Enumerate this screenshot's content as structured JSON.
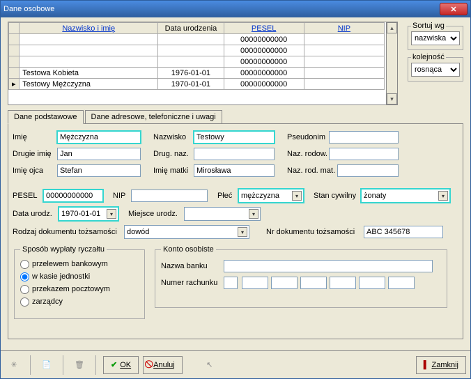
{
  "title": "Dane osobowe",
  "grid": {
    "headers": {
      "name": "Nazwisko i imię",
      "dob": "Data urodzenia",
      "pesel": "PESEL",
      "nip": "NIP"
    },
    "rows": [
      {
        "name": "",
        "dob": "",
        "pesel": "00000000000",
        "nip": ""
      },
      {
        "name": "",
        "dob": "",
        "pesel": "00000000000",
        "nip": ""
      },
      {
        "name": "",
        "dob": "",
        "pesel": "00000000000",
        "nip": ""
      },
      {
        "name": "Testowa Kobieta",
        "dob": "1976-01-01",
        "pesel": "00000000000",
        "nip": ""
      },
      {
        "name": "Testowy Mężczyzna",
        "dob": "1970-01-01",
        "pesel": "00000000000",
        "nip": "",
        "current": true
      }
    ]
  },
  "sort": {
    "legend1": "Sortuj wg",
    "value1": "nazwiska",
    "legend2": "kolejność",
    "value2": "rosnąca"
  },
  "tabs": {
    "t1": "Dane podstawowe",
    "t2": "Dane adresowe, telefoniczne i uwagi"
  },
  "labels": {
    "imie": "Imię",
    "nazwisko": "Nazwisko",
    "pseudonim": "Pseudonim",
    "drugieimie": "Drugie imię",
    "drugnaz": "Drug. naz.",
    "nazrodow": "Naz. rodow.",
    "imieojca": "Imię ojca",
    "imiematki": "Imię matki",
    "nazrodmat": "Naz. rod. mat.",
    "pesel": "PESEL",
    "nip": "NIP",
    "plec": "Płeć",
    "stan": "Stan cywilny",
    "dataurodz": "Data urodz.",
    "miejsceurodz": "Miejsce urodz.",
    "rodzdok": "Rodzaj dokumentu tożsamości",
    "nrdok": "Nr dokumentu tożsamości",
    "sposob": "Sposób wypłaty ryczałtu",
    "konto": "Konto osobiste",
    "nazwabanku": "Nazwa banku",
    "numerrach": "Numer rachunku",
    "r1": "przelewem bankowym",
    "r2": "w kasie jednostki",
    "r3": "przekazem pocztowym",
    "r4": "zarządcy"
  },
  "values": {
    "imie": "Mężczyzna",
    "nazwisko": "Testowy",
    "pseudonim": "",
    "drugieimie": "Jan",
    "drugnaz": "",
    "nazrodow": "",
    "imieojca": "Stefan",
    "imiematki": "Mirosława",
    "nazrodmat": "",
    "pesel": "00000000000",
    "nip": "",
    "plec": "mężczyzna",
    "stan": "żonaty",
    "dataurodz": "1970-01-01",
    "miejsceurodz": "",
    "rodzdok": "dowód",
    "nrdok": "ABC 345678",
    "nazwabanku": "",
    "numerrach": ""
  },
  "buttons": {
    "ok": "OK",
    "anuluj": "Anuluj",
    "zamknij": "Zamknij"
  }
}
